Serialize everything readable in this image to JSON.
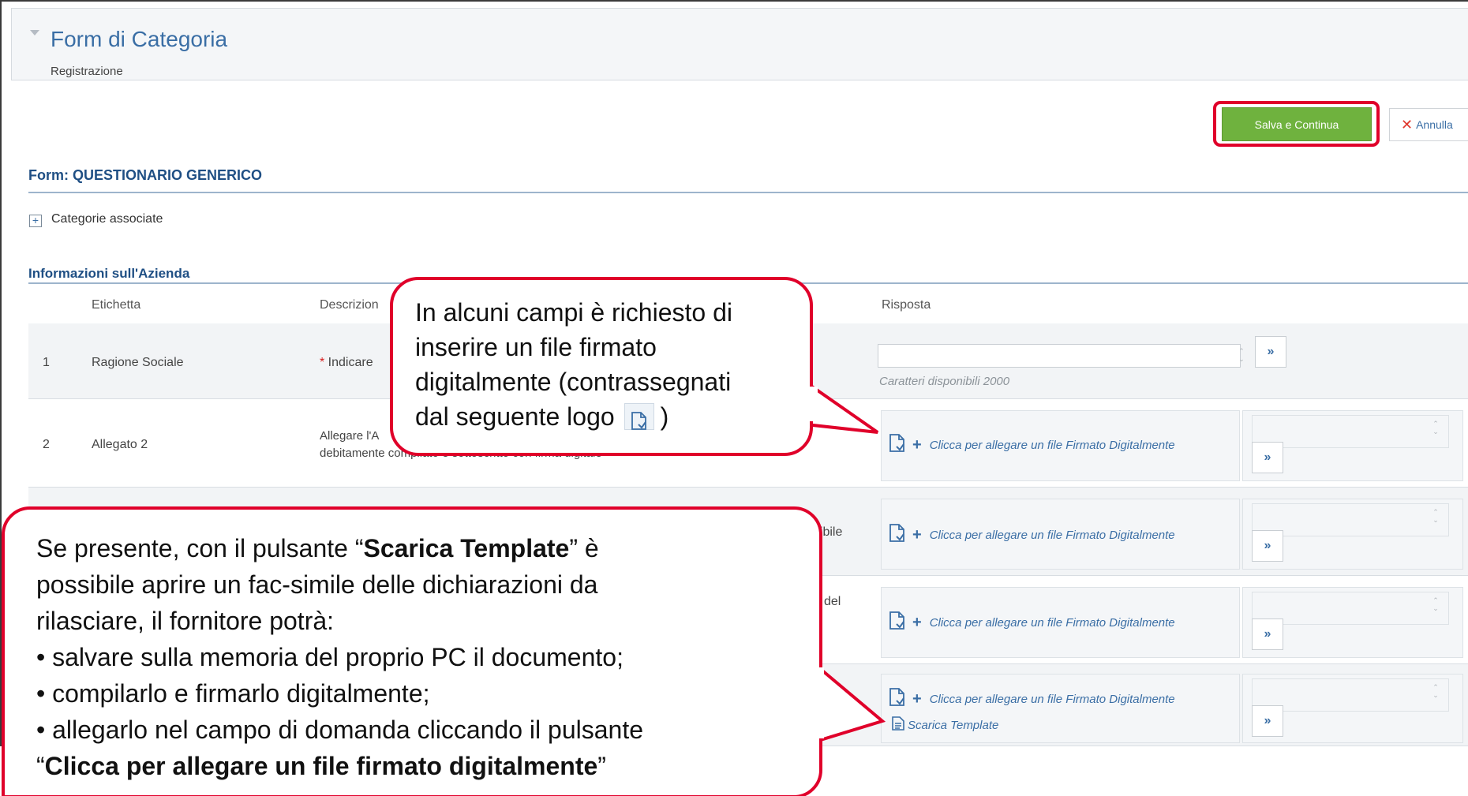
{
  "header": {
    "title": "Form di Categoria",
    "subtitle": "Registrazione"
  },
  "actions": {
    "save_label": "Salva e Continua",
    "cancel_label": "Annulla"
  },
  "form": {
    "title": "Form: QUESTIONARIO GENERICO",
    "categories_label": "Categorie associate",
    "section_title": "Informazioni sull'Azienda"
  },
  "table": {
    "headers": {
      "label": "Etichetta",
      "description": "Descrizion",
      "answer": "Risposta"
    },
    "rows": [
      {
        "num": "1",
        "label": "Ragione Sociale",
        "description": "Indicare",
        "counter": "Caratteri disponibili 2000"
      },
      {
        "num": "2",
        "label": "Allegato 2",
        "description_line1": "Allegare l'A",
        "description_line2": "debitamente compilato e sottoscritto con firma digitale",
        "attach": "Clicca per allegare un file Firmato Digitalmente"
      },
      {
        "description_tail": "nibile",
        "attach": "Clicca per allegare un file Firmato Digitalmente"
      },
      {
        "description_tail": "del",
        "attach": "Clicca per allegare un file Firmato Digitalmente"
      },
      {
        "attach": "Clicca per allegare un file Firmato Digitalmente",
        "template": "Scarica Template"
      }
    ]
  },
  "callout_top": {
    "lines": [
      "In alcuni campi è richiesto di",
      "inserire un file firmato",
      "digitalmente (contrassegnati",
      "dal seguente logo"
    ],
    "suffix": ")"
  },
  "callout_bottom": {
    "p1_pre": "Se presente, con il pulsante “",
    "p1_bold": "Scarica Template",
    "p1_post": "” è",
    "p2": "possibile aprire un fac-simile delle dichiarazioni da",
    "p3": "rilasciare, il fornitore potrà:",
    "b1": "• salvare sulla memoria del proprio PC il documento;",
    "b2": "• compilarlo e firmarlo digitalmente;",
    "b3": "• allegarlo nel campo di domanda cliccando il pulsante",
    "b4_open": "“",
    "b4_bold": "Clicca per allegare un file firmato digitalmente",
    "b4_close": "”"
  },
  "colors": {
    "accent": "#3a6ea5",
    "save": "#6fb23e",
    "highlight": "#e0002a"
  },
  "icons": [
    "caret-down-icon",
    "plus-box-icon",
    "close-icon",
    "signed-file-icon",
    "chevron-double-down-icon",
    "document-icon"
  ]
}
